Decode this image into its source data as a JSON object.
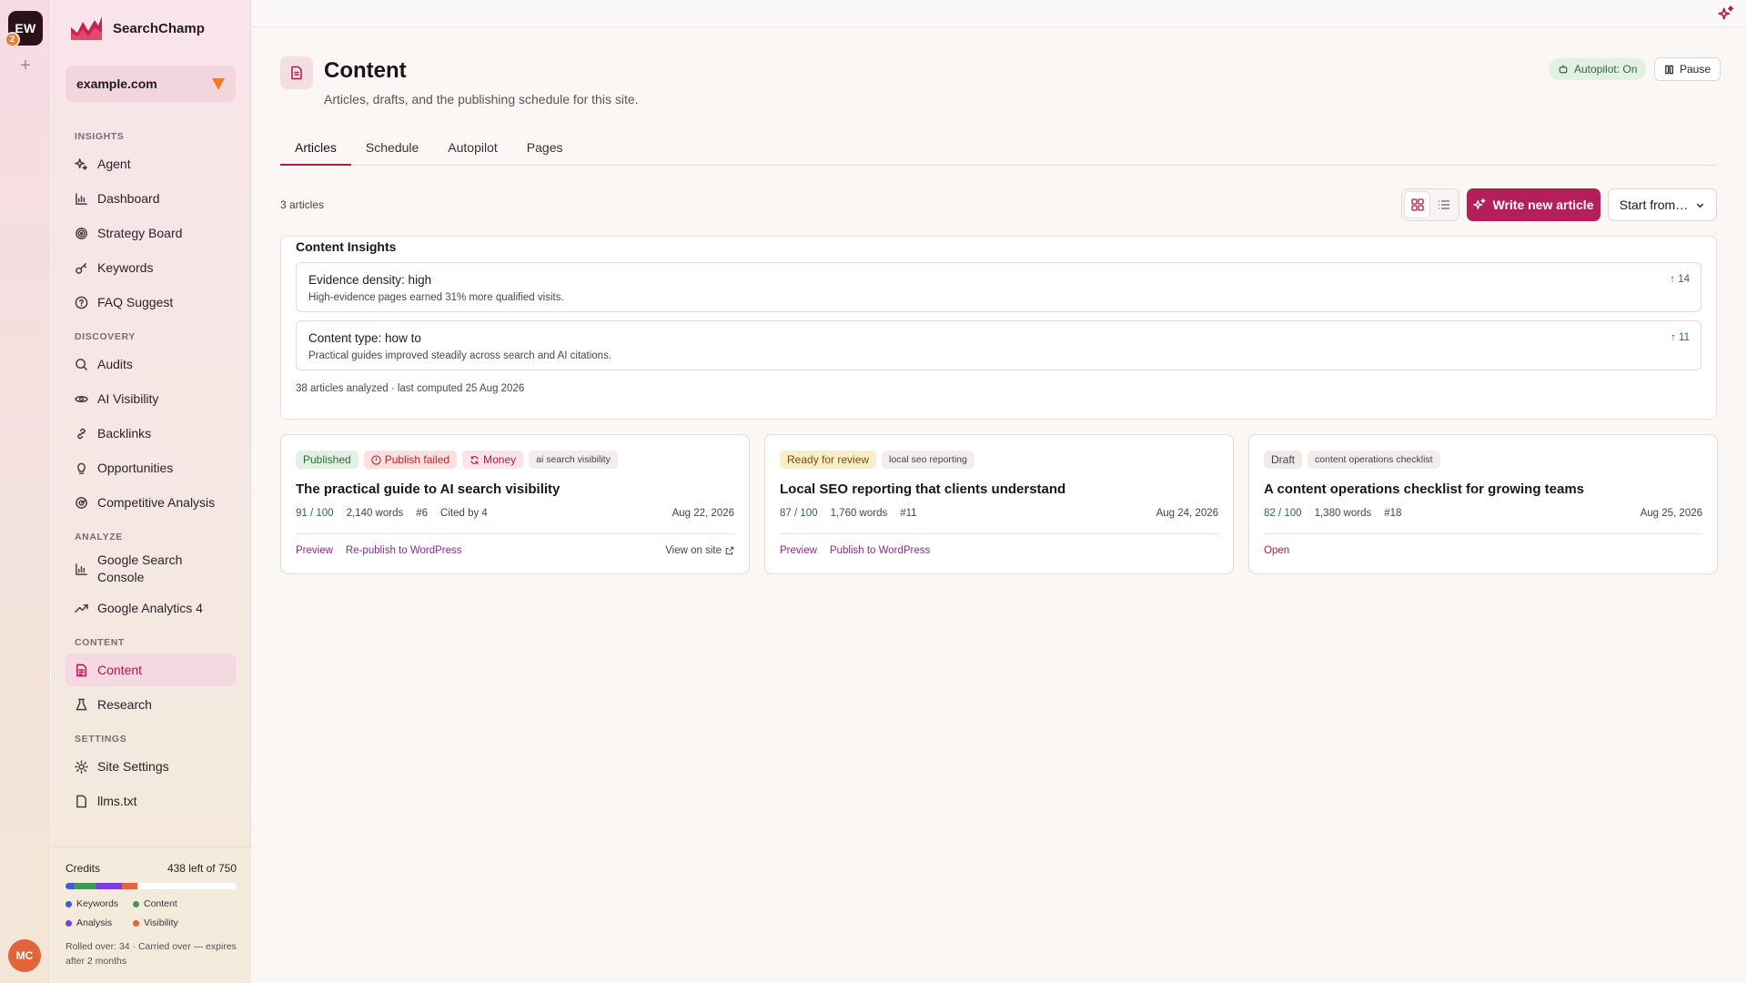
{
  "workspace": {
    "initials": "EW",
    "badge_count": "2",
    "add_symbol": "+",
    "user_initials": "MC"
  },
  "brand": {
    "name": "SearchChamp"
  },
  "site_selector": {
    "value": "example.com"
  },
  "nav": {
    "insights_label": "INSIGHTS",
    "agent": "Agent",
    "dashboard": "Dashboard",
    "strategy_board": "Strategy Board",
    "keywords": "Keywords",
    "faq_suggest": "FAQ Suggest",
    "discovery_label": "DISCOVERY",
    "audits": "Audits",
    "ai_visibility": "AI Visibility",
    "backlinks": "Backlinks",
    "opportunities": "Opportunities",
    "competitive_analysis": "Competitive Analysis",
    "analyze_label": "ANALYZE",
    "google_search_console": "Google Search Console",
    "google_analytics": "Google Analytics 4",
    "content_label": "CONTENT",
    "content": "Content",
    "research": "Research",
    "settings_label": "SETTINGS",
    "site_settings": "Site Settings",
    "llms": "llms.txt"
  },
  "credits": {
    "label": "Credits",
    "remaining": "438 left of 750",
    "used_fractions": {
      "keywords": 0.05,
      "content": 0.13,
      "analysis": 0.15,
      "visibility": 0.09
    },
    "legend": {
      "keywords": "Keywords",
      "content": "Content",
      "analysis": "Analysis",
      "visibility": "Visibility"
    },
    "colors": {
      "keywords": "#3b5bdb",
      "content": "#3f9a4f",
      "analysis": "#7b3fe0",
      "visibility": "#e0653a"
    },
    "note": "Rolled over: 34 · Carried over — expires after 2 months"
  },
  "page": {
    "title": "Content",
    "subtitle": "Articles, drafts, and the publishing schedule for this site.",
    "autopilot_status": "Autopilot: On",
    "pause_label": "Pause"
  },
  "tabs": {
    "articles": "Articles",
    "schedule": "Schedule",
    "autopilot": "Autopilot",
    "pages": "Pages"
  },
  "toolbar": {
    "count": "3 articles",
    "write_label": "Write new article",
    "start_label": "Start from…"
  },
  "insights": {
    "title": "Content Insights",
    "items": [
      {
        "title": "Evidence density: high",
        "desc": "High-evidence pages earned 31% more qualified visits.",
        "delta": "14"
      },
      {
        "title": "Content type: how to",
        "desc": "Practical guides improved steadily across search and AI citations.",
        "delta": "11"
      }
    ],
    "footer": "38 articles analyzed · last computed 25 Aug 2026"
  },
  "articles": [
    {
      "status": "Published",
      "failed": "Publish failed",
      "money": "Money",
      "keyword": "ai search visibility",
      "title": "The practical guide to AI search visibility",
      "score": "91 / 100",
      "words": "2,140 words",
      "rank": "#6",
      "cited": "Cited by 4",
      "date": "Aug 22, 2026",
      "action1": "Preview",
      "action2": "Re-publish to WordPress",
      "view": "View on site"
    },
    {
      "status": "Ready for review",
      "keyword": "local seo reporting",
      "title": "Local SEO reporting that clients understand",
      "score": "87 / 100",
      "words": "1,760 words",
      "rank": "#11",
      "date": "Aug 24, 2026",
      "action1": "Preview",
      "action2": "Publish to WordPress"
    },
    {
      "status": "Draft",
      "keyword": "content operations checklist",
      "title": "A content operations checklist for growing teams",
      "score": "82 / 100",
      "words": "1,380 words",
      "rank": "#18",
      "date": "Aug 25, 2026",
      "action1": "Open"
    }
  ],
  "colors": {
    "accent": "#b31f58",
    "success": "#2e6a3b",
    "brand_orange": "#e97f2e"
  }
}
